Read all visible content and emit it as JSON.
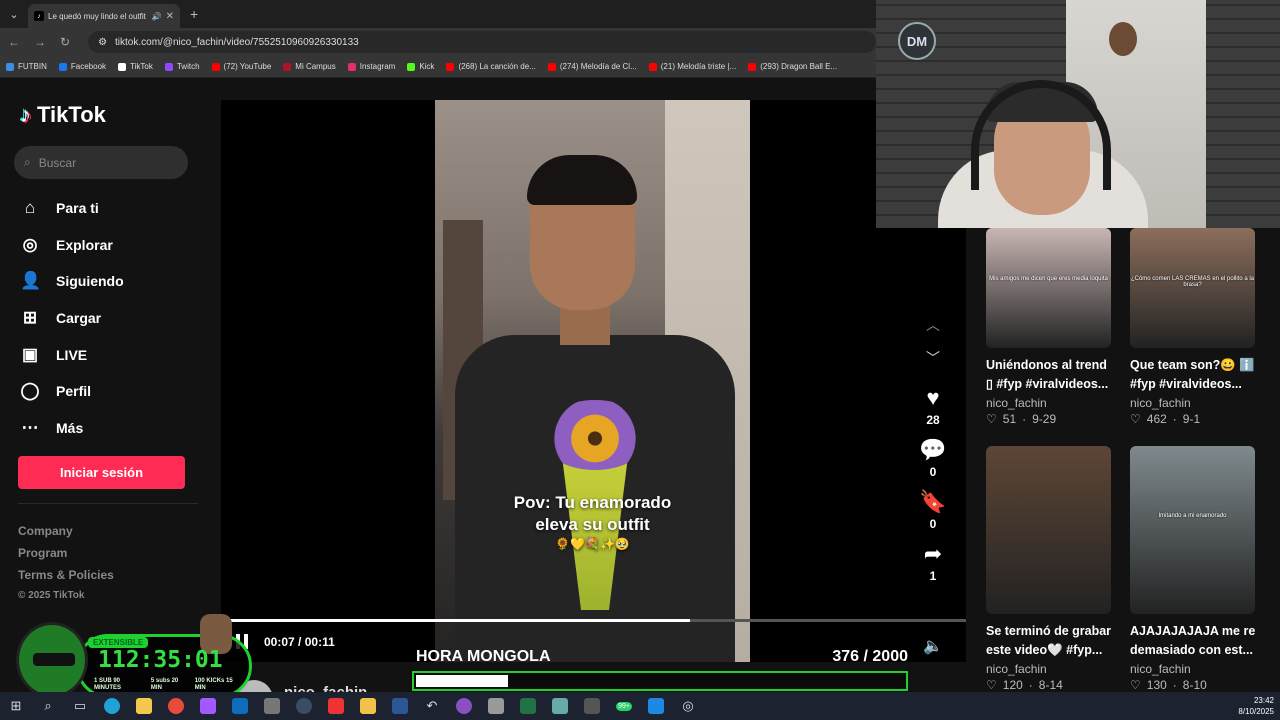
{
  "browser": {
    "tab_title": "Le quedó muy lindo el outfit",
    "url": "tiktok.com/@nico_fachin/video/7552510960926330133",
    "bookmarks": [
      {
        "label": "FUTBIN",
        "color": "#3a8ee6"
      },
      {
        "label": "Facebook",
        "color": "#1877f2"
      },
      {
        "label": "TikTok",
        "color": "#ffffff"
      },
      {
        "label": "Twitch",
        "color": "#9146ff"
      },
      {
        "label": "(72) YouTube",
        "color": "#ff0000"
      },
      {
        "label": "Mi Campus",
        "color": "#b0122a"
      },
      {
        "label": "Instagram",
        "color": "#e1306c"
      },
      {
        "label": "Kick",
        "color": "#53fc18"
      },
      {
        "label": "(268) La canción de...",
        "color": "#ff0000"
      },
      {
        "label": "(274) Melodía de Cl...",
        "color": "#ff0000"
      },
      {
        "label": "(21) Melodía triste |...",
        "color": "#ff0000"
      },
      {
        "label": "(293) Dragon Ball E...",
        "color": "#ff0000"
      }
    ]
  },
  "sidebar": {
    "logo": "TikTok",
    "search_placeholder": "Buscar",
    "nav": [
      {
        "icon": "home",
        "label": "Para ti"
      },
      {
        "icon": "compass",
        "label": "Explorar"
      },
      {
        "icon": "following",
        "label": "Siguiendo"
      },
      {
        "icon": "upload",
        "label": "Cargar"
      },
      {
        "icon": "live",
        "label": "LIVE"
      },
      {
        "icon": "profile",
        "label": "Perfil"
      },
      {
        "icon": "more",
        "label": "Más"
      }
    ],
    "login_label": "Iniciar sesión",
    "footer_links": [
      "Company",
      "Program",
      "Terms & Policies"
    ],
    "copyright": "© 2025 TikTok"
  },
  "video": {
    "overlay_line1": "Pov: Tu enamorado",
    "overlay_line2": "eleva su outfit",
    "overlay_emojis": "🌻💛💐✨🥹",
    "likes": "28",
    "comments": "0",
    "saves": "0",
    "shares": "1",
    "current_time": "00:07",
    "duration": "00:11",
    "progress": 0.63,
    "author": "nico_fachin"
  },
  "related": [
    {
      "title": "Uniéndonos al trend",
      "title2": "▯ #fyp #viralvideos...",
      "author": "nico_fachin",
      "likes": "51",
      "date": "9-29",
      "thumb_caption": "Mis amigos me dicen que eres media loquita",
      "thumb_color": "#c9b6b4"
    },
    {
      "title": "Que team son?😀 ℹ️",
      "title2": "#fyp #viralvideos...",
      "author": "nico_fachin",
      "likes": "462",
      "date": "9-1",
      "thumb_caption": "¿Cómo comen LAS CREMAS en el pollito a la brasa?",
      "thumb_color": "#8c6e5c"
    },
    {
      "title": "Se terminó de grabar",
      "title2": "este video🤍 #fyp...",
      "author": "nico_fachin",
      "likes": "120",
      "date": "8-14",
      "thumb_caption": "",
      "thumb_color": "#5e4636"
    },
    {
      "title": "AJAJAJAJAJA me reí",
      "title2": "demasiado con est...",
      "author": "nico_fachin",
      "likes": "130",
      "date": "8-10",
      "thumb_caption": "Imitando a mi enamorado",
      "thumb_color": "#7f8a8e"
    }
  ],
  "stream": {
    "webcam_logo": "DM",
    "timer_badge": "EXTENSIBLE",
    "timer_value": "112:35:01",
    "timer_sub": [
      "1 SUB 90 MINUTES",
      "5 subs 20 MIN",
      "100 KICKs 15 MIN"
    ],
    "goal_label": "HORA MONGOLA",
    "goal_current": "376",
    "goal_target": "/ 2000",
    "goal_progress": 0.188,
    "accent": "#1fd12e"
  },
  "taskbar": {
    "time": "23:42",
    "date": "8/10/2025",
    "badge": "99+"
  }
}
